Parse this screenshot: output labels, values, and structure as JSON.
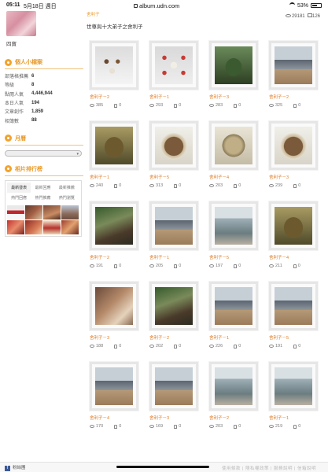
{
  "status_bar": {
    "time": "05:11",
    "date": "5月18日 週日",
    "url": "album.udn.com",
    "battery": "53%"
  },
  "sidebar": {
    "username": "四寶",
    "profile_title": "個人小檔案",
    "stats": [
      {
        "key": "部落格推薦",
        "value": "6"
      },
      {
        "key": "等級",
        "value": "8"
      },
      {
        "key": "點閱人氣",
        "value": "4,446,944"
      },
      {
        "key": "本日人氣",
        "value": "194"
      },
      {
        "key": "文章創作",
        "value": "1,859"
      },
      {
        "key": "相簿數",
        "value": "88"
      }
    ],
    "monthly_title": "月曆",
    "ranking_title": "相片排行榜",
    "ranking_tabs": [
      "最新發表",
      "最新回應",
      "最新推薦",
      "熱門回應",
      "熱門推薦",
      "熱門瀏覽"
    ]
  },
  "main": {
    "breadcrumb": "舍利子",
    "title": "世尊與十大弟子之舍利子",
    "views": "29181",
    "pictures": "126"
  },
  "photos": [
    {
      "caption": "舍利子－2",
      "views": "385",
      "likes": "0",
      "style": "p1"
    },
    {
      "caption": "舍利子－1",
      "views": "293",
      "likes": "0",
      "style": "p2"
    },
    {
      "caption": "舍利子－3",
      "views": "283",
      "likes": "0",
      "style": "p3"
    },
    {
      "caption": "舍利子－2",
      "views": "325",
      "likes": "0",
      "style": "p4"
    },
    {
      "caption": "舍利子－1",
      "views": "240",
      "likes": "0",
      "style": "p5"
    },
    {
      "caption": "舍利子－5",
      "views": "313",
      "likes": "0",
      "style": "p6"
    },
    {
      "caption": "舍利子－4",
      "views": "203",
      "likes": "0",
      "style": "p7"
    },
    {
      "caption": "舍利子－3",
      "views": "239",
      "likes": "0",
      "style": "p6"
    },
    {
      "caption": "舍利子－2",
      "views": "191",
      "likes": "0",
      "style": "p8"
    },
    {
      "caption": "舍利子－1",
      "views": "205",
      "likes": "0",
      "style": "p4"
    },
    {
      "caption": "舍利子－5",
      "views": "197",
      "likes": "0",
      "style": "p9"
    },
    {
      "caption": "舍利子－4",
      "views": "211",
      "likes": "0",
      "style": "p5"
    },
    {
      "caption": "舍利子－3",
      "views": "188",
      "likes": "0",
      "style": "p10"
    },
    {
      "caption": "舍利子－2",
      "views": "202",
      "likes": "0",
      "style": "p8"
    },
    {
      "caption": "舍利子－1",
      "views": "226",
      "likes": "0",
      "style": "p4"
    },
    {
      "caption": "舍利子－5",
      "views": "191",
      "likes": "0",
      "style": "p4"
    },
    {
      "caption": "舍利子－4",
      "views": "170",
      "likes": "0",
      "style": "p4"
    },
    {
      "caption": "舍利子－3",
      "views": "169",
      "likes": "0",
      "style": "p4"
    },
    {
      "caption": "舍利子－2",
      "views": "203",
      "likes": "0",
      "style": "p9"
    },
    {
      "caption": "舍利子－1",
      "views": "219",
      "likes": "0",
      "style": "p9"
    }
  ],
  "bottom_bar": {
    "share_label": "粉絲團",
    "links": "使用條款 | 隱私權政策 | 服務說明 | 信箱說明"
  },
  "colors": {
    "accent": "#e89a2a",
    "caption": "#e07a22"
  }
}
